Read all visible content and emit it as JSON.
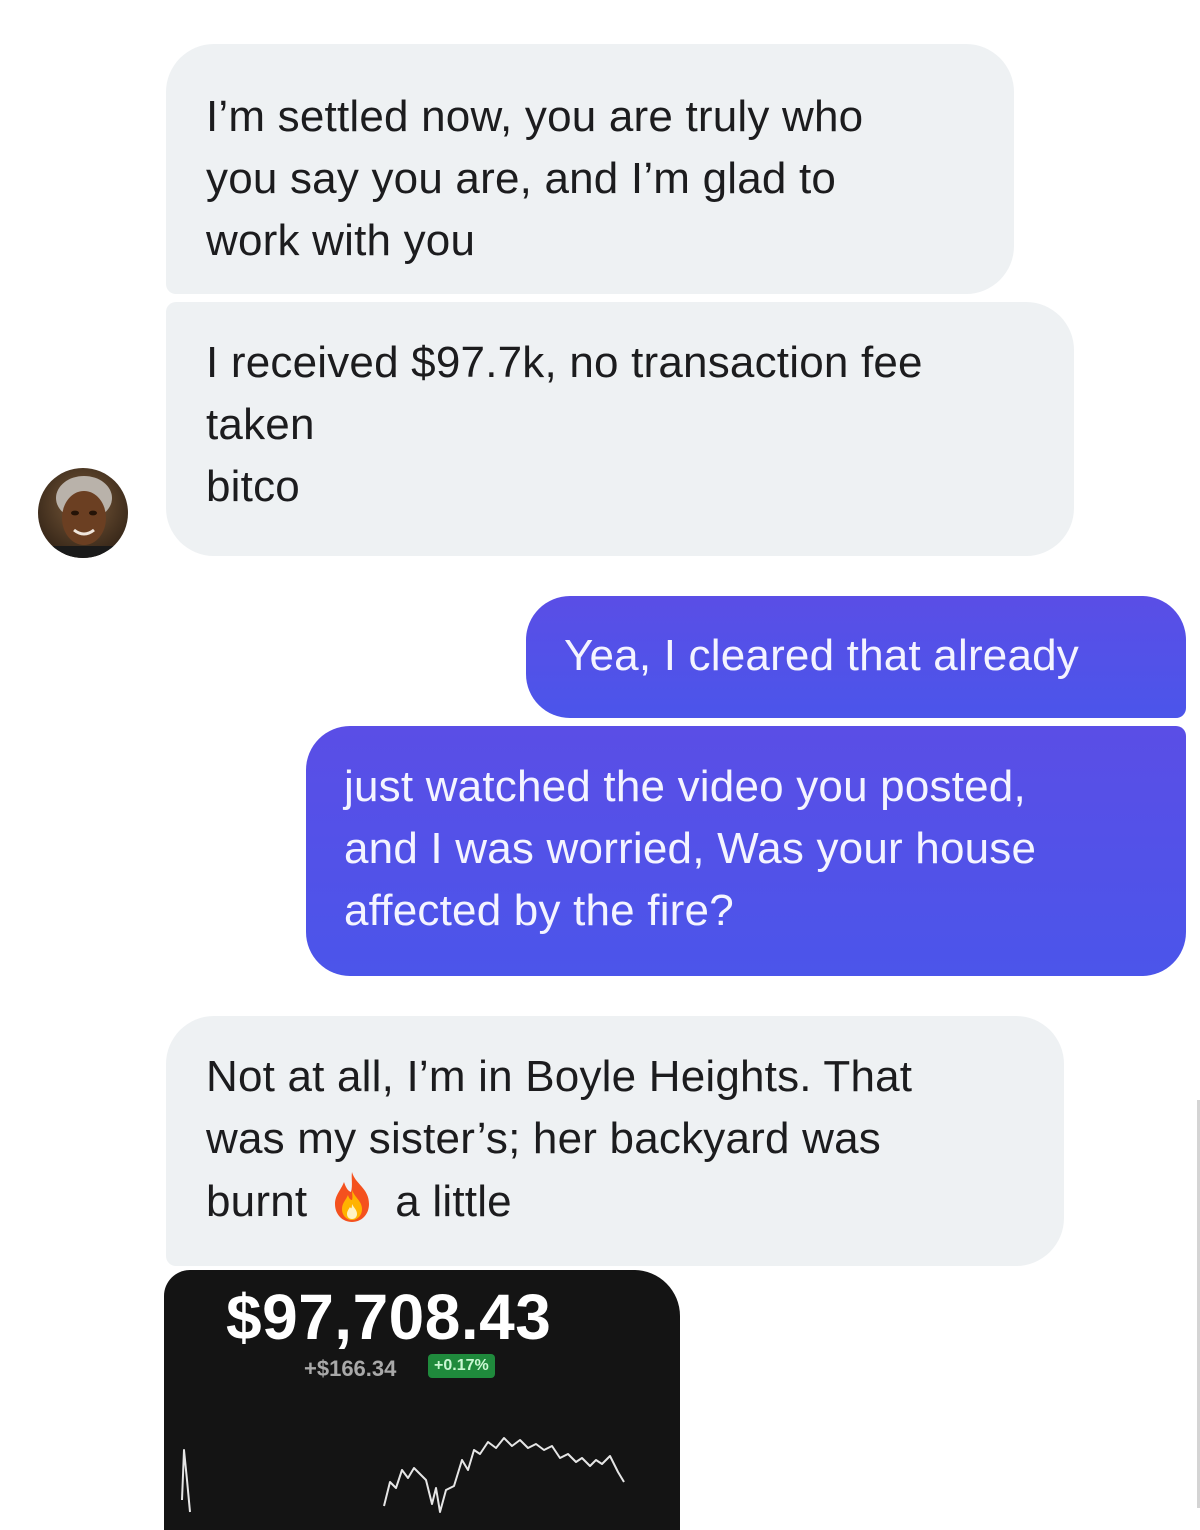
{
  "messages": [
    {
      "id": "b1",
      "direction": "incoming",
      "lines": [
        "I’m settled now, you are truly who",
        "you say you are, and I’m glad to",
        "work with you"
      ]
    },
    {
      "id": "b2",
      "direction": "incoming",
      "lines": [
        "I received $97.7k, no transaction fee",
        "taken",
        "bitco"
      ]
    },
    {
      "id": "b3",
      "direction": "outgoing",
      "lines": [
        "Yea, I cleared that already"
      ]
    },
    {
      "id": "b4",
      "direction": "outgoing",
      "lines": [
        "just watched the video you posted,",
        "and I was worried, Was your house",
        "affected by the fire?"
      ]
    },
    {
      "id": "b5",
      "direction": "incoming",
      "lines": [
        "Not at all, I’m in Boyle Heights. That",
        "was my sister’s; her backyard was"
      ],
      "last_line_before_emoji": "burnt",
      "emoji": "fire-emoji",
      "last_line_after_emoji": "a little"
    }
  ],
  "sender_avatar": {
    "icon": "avatar-photo"
  },
  "attachment": {
    "balance": "$97,708.43",
    "change": "+$166.34",
    "change_percent": "+0.17%",
    "chart": {
      "type": "line",
      "series_color": "#ffffff",
      "badge_color": "#1f8a3c"
    }
  },
  "colors": {
    "incoming_bubble": "#eef1f3",
    "outgoing_bubble": "#4b55ea",
    "background": "#ffffff"
  }
}
